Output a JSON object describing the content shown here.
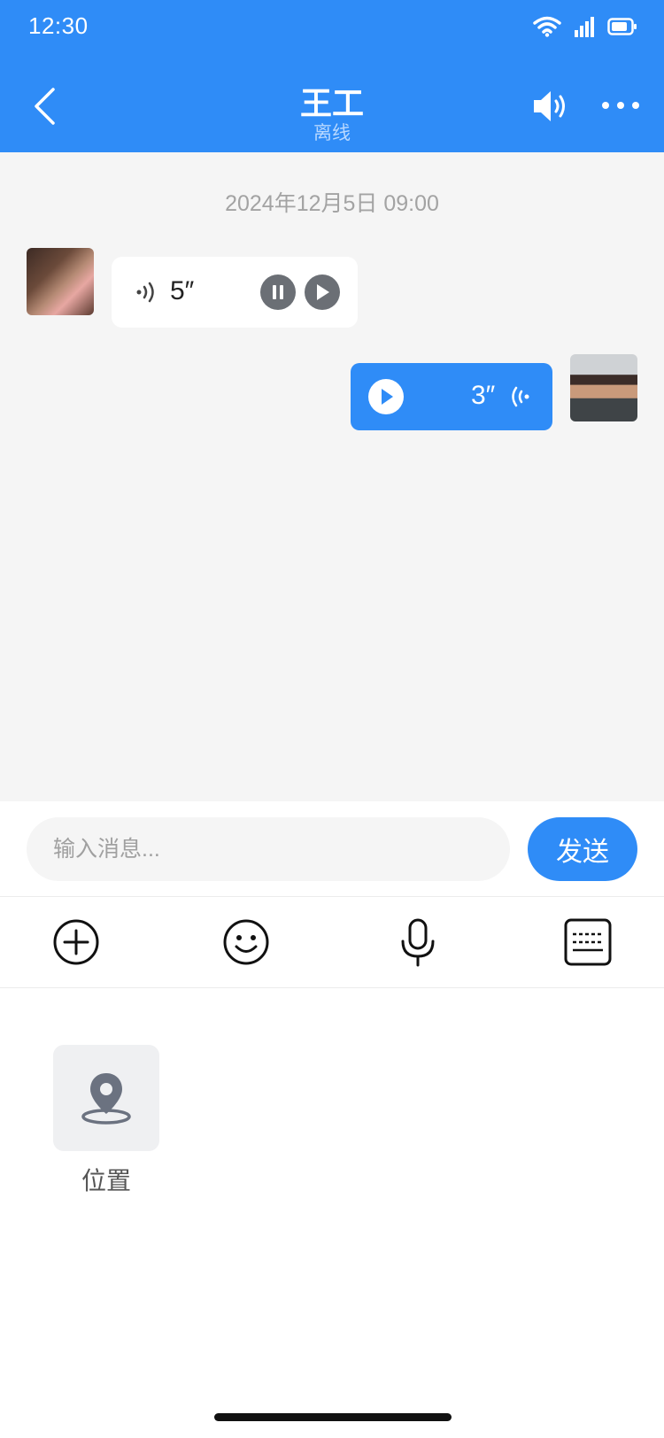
{
  "status_bar": {
    "time": "12:30"
  },
  "header": {
    "title": "王工",
    "subtitle": "离线"
  },
  "chat": {
    "timestamp": "2024年12月5日 09:00",
    "messages": [
      {
        "side": "left",
        "type": "voice",
        "duration": "5″"
      },
      {
        "side": "right",
        "type": "voice",
        "duration": "3″"
      }
    ]
  },
  "composer": {
    "placeholder": "输入消息...",
    "send_label": "发送"
  },
  "toolbar": {
    "icons": [
      "plus-circle-icon",
      "emoji-icon",
      "microphone-icon",
      "keyboard-icon"
    ]
  },
  "panel": {
    "items": [
      {
        "label": "位置",
        "icon": "location-pin-icon"
      }
    ]
  },
  "colors": {
    "primary": "#2f8cf7",
    "chat_bg": "#f5f5f5",
    "subtitle": "#b8d8ff"
  }
}
